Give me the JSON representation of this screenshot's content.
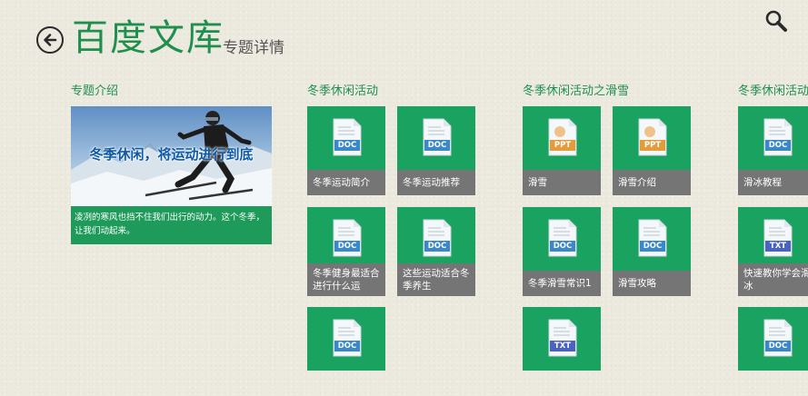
{
  "header": {
    "app_title": "百度文库",
    "subtitle": "专题详情"
  },
  "groups": [
    {
      "title": "专题介绍"
    },
    {
      "title": "冬季休闲活动"
    },
    {
      "title": "冬季休闲活动之滑雪"
    },
    {
      "title": "冬季休闲活动之滑冰"
    }
  ],
  "hero": {
    "image_text": "冬季休闲，将运动进行到底",
    "description": "凌冽的寒风也挡不住我们出行的动力。这个冬季，让我们动起来。"
  },
  "tiles": [
    {
      "label": "冬季运动简介",
      "type": "DOC"
    },
    {
      "label": "冬季运动推荐",
      "type": "DOC"
    },
    {
      "label": "冬季健身最适合进行什么运",
      "type": "DOC"
    },
    {
      "label": "这些运动适合冬季养生",
      "type": "DOC"
    },
    {
      "label": "",
      "type": "DOC"
    },
    {
      "label": "滑雪",
      "type": "PPT"
    },
    {
      "label": "滑雪介绍",
      "type": "PPT"
    },
    {
      "label": "冬季滑雪常识1",
      "type": "DOC"
    },
    {
      "label": "滑雪攻略",
      "type": "DOC"
    },
    {
      "label": "",
      "type": "TXT"
    },
    {
      "label": "滑冰教程",
      "type": "DOC"
    },
    {
      "label": "快速教你学会滑冰",
      "type": "TXT"
    },
    {
      "label": "",
      "type": "DOC"
    }
  ],
  "colors": {
    "accent_green": "#1f8f4e",
    "tile_green": "#1aa260",
    "tile_label_bg": "#757575",
    "doc_tag": "#3a87c9",
    "ppt_tag": "#e49b3a",
    "txt_tag": "#4a63c2"
  }
}
